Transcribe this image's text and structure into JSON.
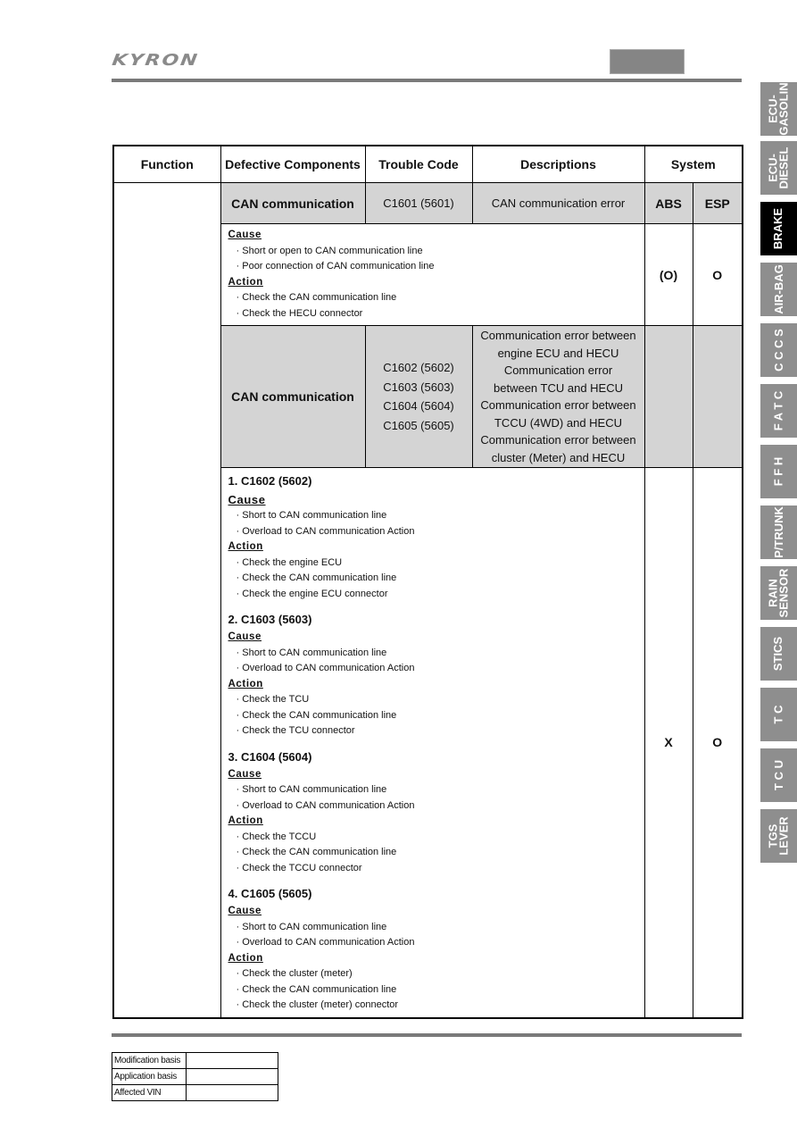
{
  "header": {
    "brand": "KYRON"
  },
  "side_tabs": [
    {
      "label": "ECU-\nGASOLIN",
      "active": false
    },
    {
      "label": "ECU-\nDIESEL",
      "active": false
    },
    {
      "label": "BRAKE",
      "active": true
    },
    {
      "label": "AIR-BAG",
      "active": false
    },
    {
      "label": "C C C S",
      "active": false
    },
    {
      "label": "F A T C",
      "active": false
    },
    {
      "label": "F F H",
      "active": false
    },
    {
      "label": "P/TRUNK",
      "active": false
    },
    {
      "label": "RAIN\nSENSOR",
      "active": false
    },
    {
      "label": "STICS",
      "active": false
    },
    {
      "label": "T C",
      "active": false
    },
    {
      "label": "T C U",
      "active": false
    },
    {
      "label": "TGS\nLEVER",
      "active": false
    }
  ],
  "table": {
    "headers": {
      "function": "Function",
      "components": "Defective Components",
      "code": "Trouble Code",
      "descriptions": "Descriptions",
      "system": "System"
    },
    "system_cols": {
      "abs": "ABS",
      "esp": "ESP"
    },
    "row1": {
      "component": "CAN communication",
      "code": "C1601 (5601)",
      "description": "CAN communication error",
      "cause_label": "Cause",
      "causes": [
        "Short or open to CAN communication line",
        "Poor connection of CAN communication line"
      ],
      "action_label": "Action",
      "actions": [
        "Check the CAN communication line",
        "Check the HECU connector"
      ],
      "abs": "(O)",
      "esp": "O"
    },
    "row2": {
      "component": "CAN communication",
      "codes": [
        "C1602 (5602)",
        "C1603 (5603)",
        "C1604 (5604)",
        "C1605 (5605)"
      ],
      "descriptions": [
        "Communication error between",
        "engine ECU and HECU",
        "Communication error",
        "between TCU and HECU",
        "Communication error between",
        "TCCU (4WD) and HECU",
        "Communication error between",
        "cluster (Meter) and HECU"
      ],
      "abs": "X",
      "esp": "O",
      "sections": [
        {
          "title": "1. C1602 (5602)",
          "cause_label": "Cause",
          "causes": [
            "Short to CAN communication line",
            "Overload to CAN communication Action"
          ],
          "action_label": "Action",
          "actions": [
            "Check the engine ECU",
            "Check the CAN communication line",
            "Check the engine ECU connector"
          ]
        },
        {
          "title": "2. C1603 (5603)",
          "cause_label": "Cause",
          "causes": [
            "Short to CAN communication line",
            "Overload to CAN communication Action"
          ],
          "action_label": "Action",
          "actions": [
            "Check the TCU",
            "Check the CAN communication line",
            "Check the TCU connector"
          ]
        },
        {
          "title": "3. C1604 (5604)",
          "cause_label": "Cause",
          "causes": [
            "Short to CAN communication line",
            "Overload to CAN communication Action"
          ],
          "action_label": "Action",
          "actions": [
            "Check the TCCU",
            "Check the CAN communication line",
            "Check the TCCU connector"
          ]
        },
        {
          "title": "4. C1605 (5605)",
          "cause_label": "Cause",
          "causes": [
            "Short to CAN communication line",
            "Overload to CAN communication Action"
          ],
          "action_label": "Action",
          "actions": [
            "Check the cluster (meter)",
            "Check the CAN communication line",
            "Check the cluster (meter) connector"
          ]
        }
      ]
    }
  },
  "footer_table": [
    {
      "label": "Modification basis",
      "value": ""
    },
    {
      "label": "Application basis",
      "value": ""
    },
    {
      "label": "Affected VIN",
      "value": ""
    }
  ]
}
